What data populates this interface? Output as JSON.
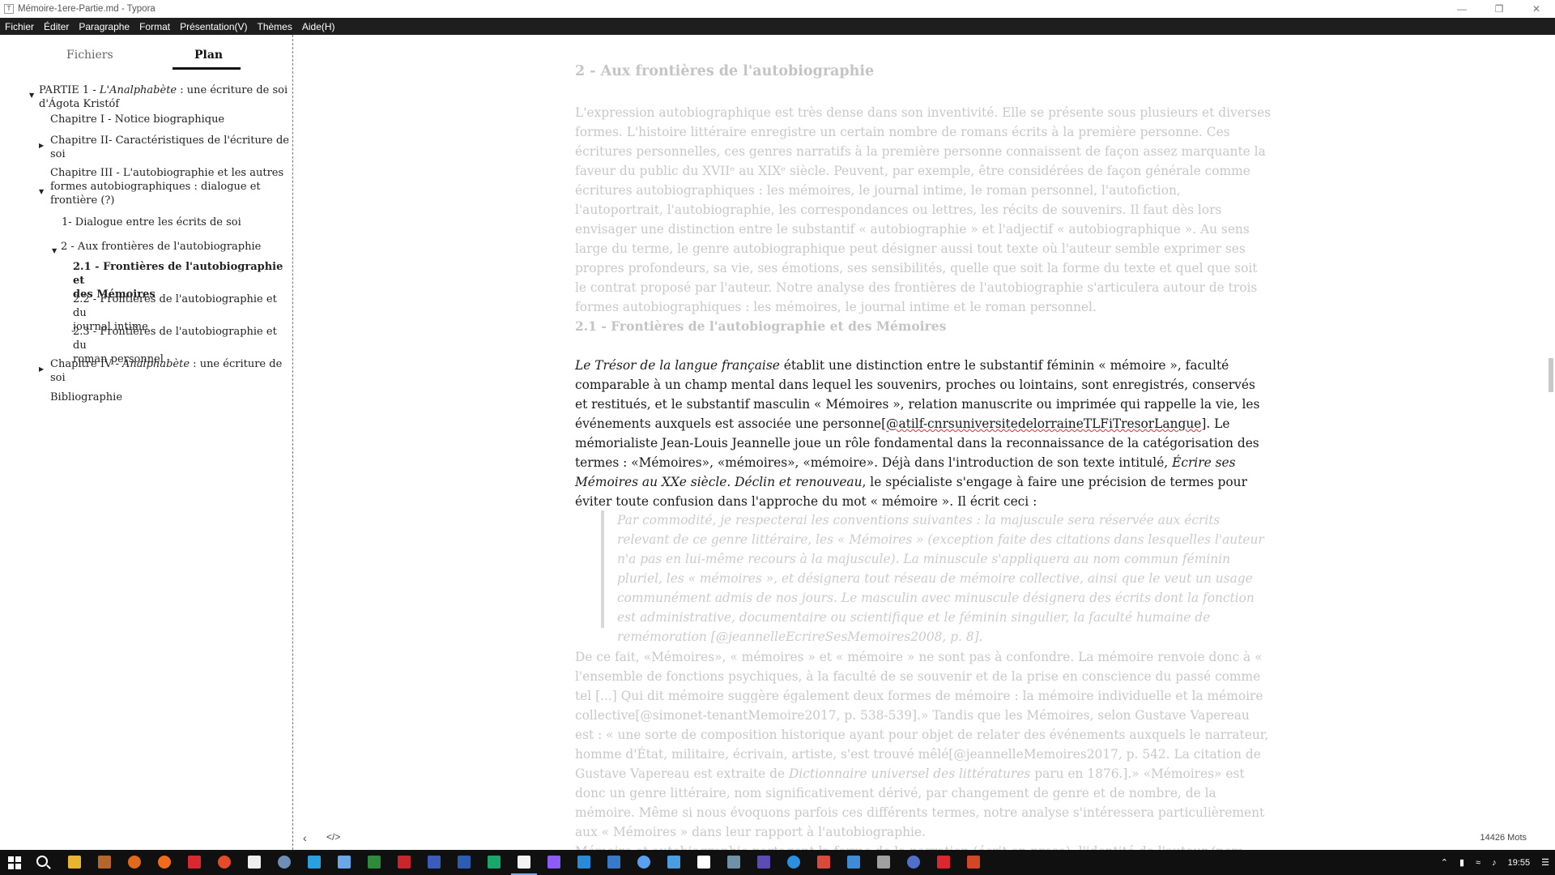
{
  "window": {
    "title": "Mémoire-1ere-Partie.md - Typora",
    "app_icon": "T"
  },
  "menu": [
    "Fichier",
    "Éditer",
    "Paragraphe",
    "Format",
    "Présentation(V)",
    "Thèmes",
    "Aide(H)"
  ],
  "sidebar": {
    "tabs": {
      "files": "Fichiers",
      "outline": "Plan"
    },
    "outline": {
      "part1_a": "PARTIE 1 - ",
      "part1_b": "L'Analphabète",
      "part1_c": " : une écriture de soi",
      "part1_d": "d'Ágota Kristóf",
      "ch1": "Chapitre I - Notice biographique",
      "ch2_a": "Chapitre II- Caractéristiques de l'écriture de",
      "ch2_b": "soi",
      "ch3_a": "Chapitre III - L'autobiographie et les autres",
      "ch3_b": "formes autobiographiques : dialogue et",
      "ch3_c": "frontière (?)",
      "s1": "1- Dialogue entre les écrits de soi",
      "s2": "2 - Aux frontières de l'autobiographie",
      "s21_a": "2.1 - Frontières de l'autobiographie et",
      "s21_b": "des Mémoires",
      "s22_a": "2.2 - Frontières de l'autobiographie et du",
      "s22_b": "journal intime",
      "s23_a": "2.3 - Frontières de l'autobiographie et du",
      "s23_b": "roman personnel",
      "ch4_a": "Chapitre IV - ",
      "ch4_b": "Analphabète",
      "ch4_c": " : une écriture de",
      "ch4_d": "soi",
      "biblio": "Bibliographie"
    }
  },
  "document": {
    "h2": "2 - Aux frontières de l'autobiographie",
    "p1": "L'expression autobiographique est très dense dans son inventivité. Elle se présente sous plusieurs et diverses formes. L'histoire littéraire enregistre un certain nombre de romans écrits à la première personne. Ces écritures personnelles, ces genres narratifs à la première personne connaissent de façon assez marquante la faveur du public du XVIIᵉ au XIXᵉ siècle. Peuvent, par exemple, être considérées de façon générale comme écritures autobiographiques : les mémoires, le journal intime, le roman personnel, l'autofiction, l'autoportrait, l'autobiographie, les correspondances ou lettres, les récits de souvenirs. Il faut dès lors envisager une distinction entre le substantif « autobiographie » et l'adjectif « autobiographique ». Au sens large du terme, le genre autobiographique peut désigner aussi tout texte où l'auteur semble exprimer ses propres profondeurs, sa vie, ses émotions, ses sensibilités, quelle que soit la forme du texte et quel que soit le contrat proposé par l'auteur. Notre analyse des frontières de l'autobiographie s'articulera autour de trois formes autobiographiques : les mémoires, le journal intime et le roman personnel.",
    "h3": "2.1 - Frontières de l'autobiographie et des Mémoires",
    "p2_i1": "Le Trésor de la langue française",
    "p2_t1": " établit une distinction entre le substantif féminin « mémoire », faculté comparable à un champ mental dans lequel les souvenirs, proches ou lointains, sont enregistrés, conservés et restitués, et le substantif masculin « Mémoires », relation manuscrite ou imprimée qui rappelle la vie, les événements auxquels est associée une personne[",
    "p2_cite": "@atilf-cnrsuniversitedelorraineTLFiTresorLangue",
    "p2_t2": "]. Le mémorialiste Jean-Louis Jeannelle joue un rôle fondamental dans la reconnaissance de la catégorisation des termes : «Mémoires», «mémoires», «mémoire». Déjà dans l'introduction de son texte intitulé, ",
    "p2_i2": "Écrire ses Mémoires au XXe siècle. Déclin et renouveau",
    "p2_t3": ", le spécialiste s'engage à faire une précision de termes pour éviter toute confusion dans l'approche du mot « mémoire ». Il écrit ceci :",
    "quote": "Par commodité, je respecterai les conventions suivantes : la majuscule sera réservée aux écrits relevant de ce genre littéraire, les « Mémoires » (exception faite des citations dans lesquelles l'auteur n'a pas en lui-même recours à la majuscule). La minuscule s'appliquera au nom commun féminin pluriel, les « mémoires », et désignera tout réseau de mémoire collective, ainsi que le veut un usage communément admis de nos jours. Le masculin avec minuscule désignera des écrits dont la fonction est administrative, documentaire ou scientifique et le féminin singulier, la faculté humaine de remémoration [@jeannelleEcrireSesMemoires2008, p. 8].",
    "p3_a": "De ce fait, «Mémoires», « mémoires » et « mémoire » ne sont pas à confondre. La mémoire renvoie donc à « l'ensemble de fonctions psychiques, à la faculté de se souvenir et de la prise en conscience du passé comme tel [...] Qui dit mémoire suggère également deux formes de mémoire : la mémoire individuelle et la mémoire collective[@simonet-tenantMemoire2017, p. 538-539].» Tandis que les Mémoires, selon Gustave Vapereau est : « une sorte de composition historique ayant pour objet de relater des événements auxquels le narrateur, homme d'État, militaire, écrivain, artiste, s'est trouvé mêlé[@jeannelleMemoires2017, p. 542. La citation de Gustave Vapereau est extraite de ",
    "p3_i": "Dictionnaire universel des littératures",
    "p3_b": " paru en 1876.].» «Mémoires» est donc un genre littéraire, nom significativement dérivé, par changement de genre et de nombre, de la mémoire. Même si nous évoquons parfois ces différents termes, notre analyse s'intéressera particulièrement aux « Mémoires » dans leur rapport à l'autobiographie.",
    "p4": "Mémoire et autobiographie partagent la forme de la narration (écrit en prose), l'identité de l'auteur (nom"
  },
  "footer": {
    "word_count": "14426 Mots",
    "back_icon": "‹",
    "source_icon": "</>"
  },
  "taskbar": {
    "time": "19:55"
  },
  "colors": {
    "menubar": "#1e1e1e",
    "faded_text": "#c8c8c8",
    "focus_text": "#1a1a1a",
    "taskbar": "#101010"
  }
}
